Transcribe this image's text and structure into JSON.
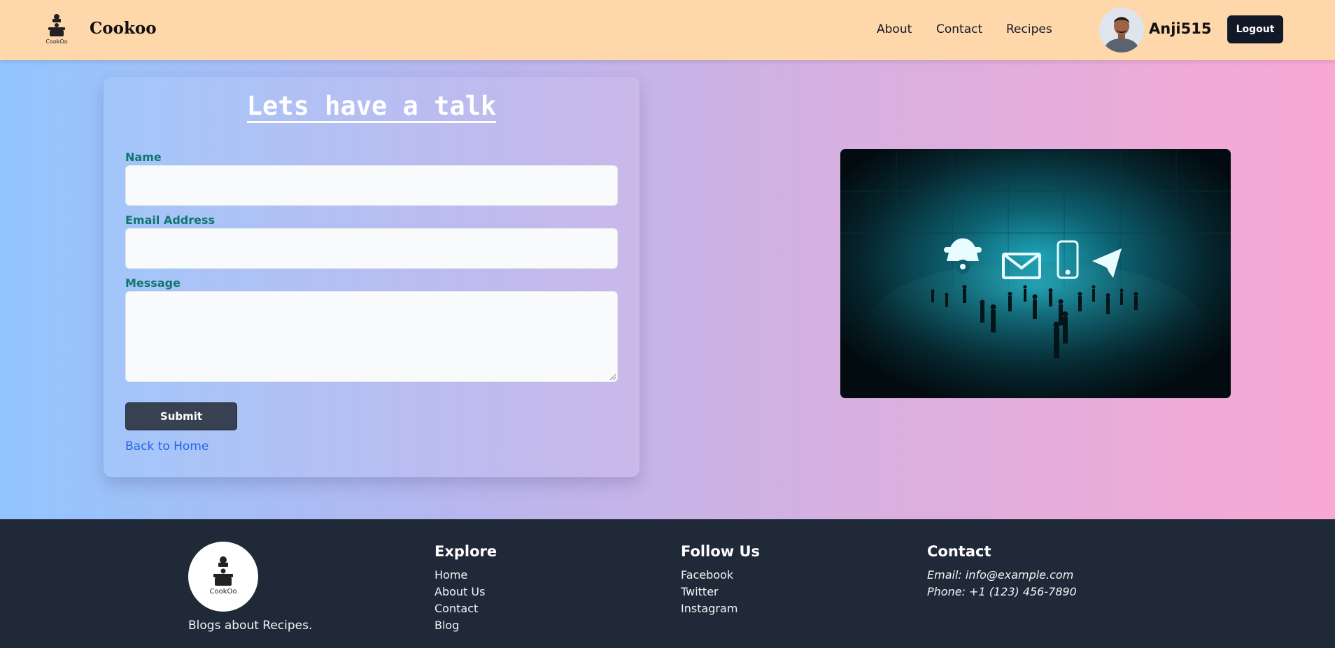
{
  "header": {
    "brand": "Cookoo",
    "nav": [
      "About",
      "Contact",
      "Recipes"
    ],
    "username": "Anji515",
    "logout_label": "Logout"
  },
  "form": {
    "title": "Lets have a talk",
    "name_label": "Name",
    "email_label": "Email Address",
    "message_label": "Message",
    "name_value": "",
    "email_value": "",
    "message_value": "",
    "submit_label": "Submit",
    "back_link": "Back to Home"
  },
  "footer": {
    "tagline": "Blogs about Recipes.",
    "explore": {
      "title": "Explore",
      "items": [
        "Home",
        "About Us",
        "Contact",
        "Blog"
      ]
    },
    "follow": {
      "title": "Follow Us",
      "items": [
        "Facebook",
        "Twitter",
        "Instagram"
      ]
    },
    "contact": {
      "title": "Contact",
      "email": "Email: info@example.com",
      "phone": "Phone: +1 (123) 456-7890"
    }
  },
  "logo_text": "CookOo",
  "colors": {
    "header_bg": "#fed7aa",
    "footer_bg": "#1f2937",
    "label_color": "#0f766e",
    "link_color": "#2563eb",
    "button_dark": "#111827",
    "submit_bg": "#374151"
  },
  "icons": [
    "cookoo-logo-icon",
    "avatar-photo",
    "phone-icon",
    "mail-icon",
    "mobile-icon",
    "paper-plane-icon"
  ]
}
